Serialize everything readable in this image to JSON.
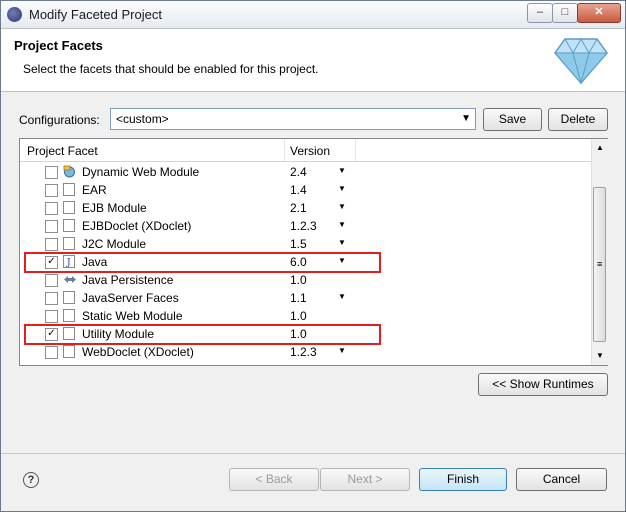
{
  "window": {
    "title": "Modify Faceted Project"
  },
  "header": {
    "title": "Project Facets",
    "description": "Select the facets that should be enabled for this project."
  },
  "config": {
    "label": "Configurations:",
    "value": "<custom>",
    "save_label": "Save",
    "delete_label": "Delete"
  },
  "table": {
    "col_facet": "Project Facet",
    "col_version": "Version",
    "rows": [
      {
        "name": "Dynamic Web Module",
        "version": "2.4",
        "checked": false,
        "icon": "globe-icon",
        "dropdown": true
      },
      {
        "name": "EAR",
        "version": "1.4",
        "checked": false,
        "icon": "document-icon",
        "dropdown": true
      },
      {
        "name": "EJB Module",
        "version": "2.1",
        "checked": false,
        "icon": "document-icon",
        "dropdown": true
      },
      {
        "name": "EJBDoclet (XDoclet)",
        "version": "1.2.3",
        "checked": false,
        "icon": "document-icon",
        "dropdown": true
      },
      {
        "name": "J2C Module",
        "version": "1.5",
        "checked": false,
        "icon": "document-icon",
        "dropdown": true
      },
      {
        "name": "Java",
        "version": "6.0",
        "checked": true,
        "icon": "java-icon",
        "dropdown": true
      },
      {
        "name": "Java Persistence",
        "version": "1.0",
        "checked": false,
        "icon": "persistence-icon",
        "dropdown": false
      },
      {
        "name": "JavaServer Faces",
        "version": "1.1",
        "checked": false,
        "icon": "document-icon",
        "dropdown": true
      },
      {
        "name": "Static Web Module",
        "version": "1.0",
        "checked": false,
        "icon": "document-icon",
        "dropdown": false
      },
      {
        "name": "Utility Module",
        "version": "1.0",
        "checked": true,
        "icon": "document-icon",
        "dropdown": false
      },
      {
        "name": "WebDoclet (XDoclet)",
        "version": "1.2.3",
        "checked": false,
        "icon": "document-icon",
        "dropdown": true
      }
    ]
  },
  "buttons": {
    "show_runtimes": "<< Show Runtimes",
    "back": "< Back",
    "next": "Next >",
    "finish": "Finish",
    "cancel": "Cancel"
  },
  "colors": {
    "highlight": "#e02020",
    "accent": "#3c7fb1"
  }
}
